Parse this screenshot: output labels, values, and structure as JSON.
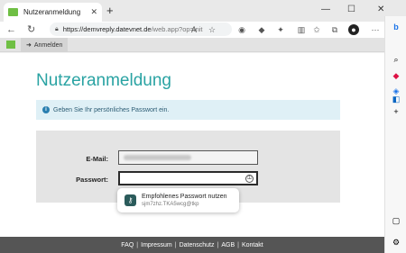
{
  "browser": {
    "tab_title": "Nutzeranmeldung",
    "tab_close": "✕",
    "new_tab": "+",
    "win_minimize": "—",
    "win_maximize": "☐",
    "win_close": "✕",
    "url_host": "https://demvreply.datevnet.de",
    "url_path": "/web.app?op=init"
  },
  "appbar": {
    "login_nav_label": "Anmelden"
  },
  "page": {
    "title": "Nutzeranmeldung",
    "info_text": "Geben Sie Ihr persönliches Passwort ein."
  },
  "form": {
    "email_label": "E-Mail:",
    "password_label": "Passwort:"
  },
  "suggestion": {
    "title": "Empfohlenes Passwort nutzen",
    "value": "sjm7zhz.TKA5wcg@tkp"
  },
  "footer": {
    "links": [
      "FAQ",
      "Impressum",
      "Datenschutz",
      "AGB",
      "Kontakt"
    ],
    "separator": "|"
  },
  "colors": {
    "accent": "#2aa3a3",
    "brand_green": "#6fbf44",
    "info_bg": "#dff0f6",
    "footer_bg": "#555555"
  }
}
